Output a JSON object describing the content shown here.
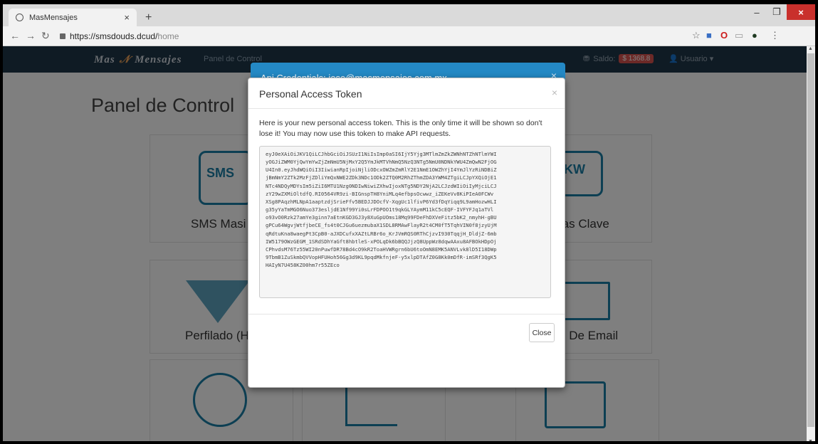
{
  "browser": {
    "tab_title": "MasMensajes",
    "tab_close": "×",
    "new_tab": "+",
    "url_host": "https://smsdouds.dcud/",
    "url_path": "home",
    "win_min": "–",
    "win_max": "❐",
    "win_close": "×"
  },
  "navbar": {
    "brand_left": "Mas",
    "brand_right": "Mensajes",
    "link": "Panel de Control",
    "saldo_label": "Saldo:",
    "saldo_value": "$ 1368.8",
    "user": "Usuario ▾"
  },
  "page": {
    "title": "Panel de Control",
    "cards": [
      {
        "label": "SMS Masi"
      },
      {
        "label": "ras Clave"
      },
      {
        "label": "Perfilado (H"
      },
      {
        "label": "s De Email"
      }
    ],
    "icon_sms": "SMS",
    "icon_kw": "KW"
  },
  "modal_back": {
    "title": "Api Credentials: jose@masmensajes.com.mx",
    "close": "×"
  },
  "modal": {
    "title": "Personal Access Token",
    "close": "×",
    "message": "Here is your new personal access token. This is the only time it will be shown so don't lose it! You may now use this token to make API requests.",
    "token_lines": [
      "eyJ0eXAiOiJKV1QiLCJhbGciOiJSUzI1NiIsImp0aSI6IjY5Yjg3MTlmZmZkZWNhNTZhNTlmYWI",
      "yOGJiZWM0YjQwYmYwZjZmNmU5NjMxY2Q5YmJkMTVhNmQ5NzQ3NTg5NmU0NDNkYWU4ZmQwN2FjOG",
      "U4In0.eyJhdWQiOiI3IiwianRpIjoiNjliODcxOWZmZmRlY2E1NmE1OWZhYjI4YmJlYzRiNDBiZ",
      "jBmNmY2ZTk2MzFjZDliYmQxNWE2ZDk3NDc1ODk2ZTQ0M2RhZThmZDA3YWM4ZTgiLCJpYXQiOjE1",
      "NTc4NDQyMDYsIm5iZiI6MTU1Nzg0NDIwNiwiZXhwIjoxNTg5NDY2NjA2LCJzdWIiOiIyMjciLCJ",
      "zY29wZXMiOltdfQ.RI0564VR9zi-BIGnspTH8YniMLq4efbpsOcwwz_iZEKeVv8KiPIeA0FCWv",
      "XSg8PAqzhMLNpA1aaptzdjSrieFfv5BEDJJDOcfV-XqgUc1lfivP6Yd3fDqYiqq9L9amHozwHLI",
      "g35yYaTmMGO6Nuo373esljdE1Nf99Yi0sLrFDPOO1t9qkGLYAymM11kC5cEQF-IVFYFJq1aTVl",
      "o93vO0Rzk27amYe3ginn7aEtnKGD3GJ3y8XuGpUOms18Mq99FDeFhDXVeFitz5bK2_nmyhH-gBU",
      "gPCu64WgvjWtfjbeCE_fs4t0CJGu6uezmubaX1SDL8RMAwFlayR2t4CM0fT5TqhVIN0f8jzyUjM",
      "qRdtuKna8waegPt3CpB0-aJXDCufxXAZtLRBr6o_KrJVmRQS0RThCjzvI930TqqjH_DldjZ-6mb",
      "IW5179OWzGEGM_1SRdSDhYaGft8hbtleS-xPOLqDk6bBQQJjzQ8UppWz8dqwAAxu8AFBOkHDpOj",
      "CPhvdsM76Tz55WI20nPuwfDR78Bd4cO9kR2ToaHVWRgrn6bU6toOmN8EMK5ANVLvk8lD5I18DWp",
      "9TbmB1ZuSkmbQVVopHFUHoh56Gg3d9KL9pqdMkfnjeF-y5xlpDTAfZ0G8Kk0mDfR-imSRf3QgK5",
      "HAIyN7U458KZ00hm7r55ZEco"
    ],
    "close_button": "Close"
  }
}
